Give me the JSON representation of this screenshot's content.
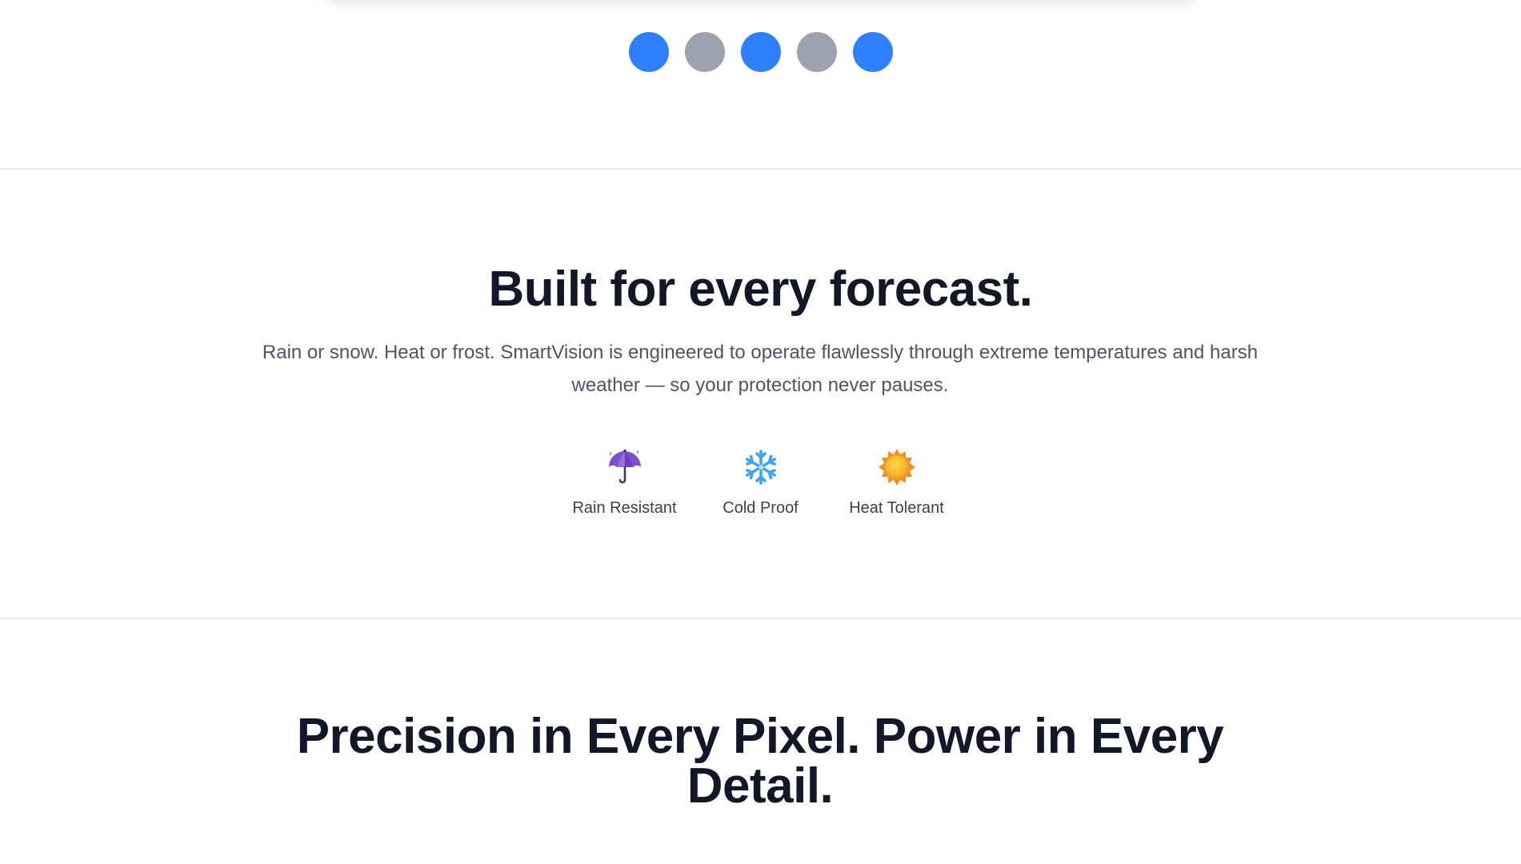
{
  "carousel": {
    "dots": [
      {
        "label": "Slide 1",
        "active": true
      },
      {
        "label": "Slide 2",
        "active": false
      },
      {
        "label": "Slide 3",
        "active": true
      },
      {
        "label": "Slide 4",
        "active": false
      },
      {
        "label": "Slide 5",
        "active": true
      }
    ],
    "colors": {
      "active": "#2f80ff",
      "inactive": "#9ca3af"
    }
  },
  "weather": {
    "title": "Built for every forecast.",
    "description": "Rain or snow. Heat or frost. SmartVision is engineered to operate flawlessly through extreme temperatures and harsh weather — so your protection never pauses.",
    "features": [
      {
        "icon": "umbrella-rain-icon",
        "label": "Rain Resistant"
      },
      {
        "icon": "snowflake-icon",
        "label": "Cold Proof"
      },
      {
        "icon": "sun-icon",
        "label": "Heat Tolerant"
      }
    ]
  },
  "precision": {
    "title": "Precision in Every Pixel. Power in Every Detail."
  }
}
